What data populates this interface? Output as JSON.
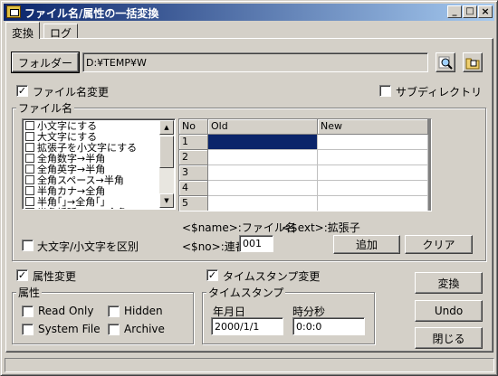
{
  "window": {
    "title": "ファイル名/属性の一括変換",
    "minimize": "_",
    "maximize": "□",
    "close": "×"
  },
  "tabs": [
    "変換",
    "ログ"
  ],
  "folder": {
    "button": "フォルダー",
    "path": "D:¥TEMP¥W"
  },
  "options": {
    "rename_checked": true,
    "rename_label": "ファイル名変更",
    "subdir_checked": false,
    "subdir_label": "サブディレクトリ"
  },
  "filename_group": {
    "title": "ファイル名",
    "rules": [
      {
        "label": "小文字にする",
        "checked": false
      },
      {
        "label": "大文字にする",
        "checked": false
      },
      {
        "label": "拡張子を小文字にする",
        "checked": false
      },
      {
        "label": "全角数字→半角",
        "checked": false
      },
      {
        "label": "全角英字→半角",
        "checked": false
      },
      {
        "label": "全角スペース→半角",
        "checked": false
      },
      {
        "label": "半角カナ→全角",
        "checked": false
      },
      {
        "label": "半角｢｣→全角｢｣",
        "checked": false
      },
      {
        "label": "半角括弧( )[ ]→全角",
        "checked": false
      }
    ],
    "grid": {
      "headers": [
        "No",
        "Old",
        "New"
      ],
      "rows": [
        {
          "no": "1",
          "old": "",
          "new": ""
        },
        {
          "no": "2",
          "old": "",
          "new": ""
        },
        {
          "no": "3",
          "old": "",
          "new": ""
        },
        {
          "no": "4",
          "old": "",
          "new": ""
        },
        {
          "no": "5",
          "old": "",
          "new": ""
        }
      ]
    },
    "case_sensitive_label": "大文字/小文字を区別",
    "case_sensitive_checked": false,
    "hint_name": "<$name>:ファイル名",
    "hint_ext": "<$ext>:拡張子",
    "hint_no": "<$no>:連番",
    "seq_value": "001",
    "add_button": "追加",
    "clear_button": "クリア"
  },
  "attributes": {
    "change_checked": true,
    "change_label": "属性変更",
    "group_title": "属性",
    "read_only": "Read Only",
    "hidden": "Hidden",
    "system_file": "System File",
    "archive": "Archive"
  },
  "timestamp": {
    "change_checked": true,
    "change_label": "タイムスタンプ変更",
    "group_title": "タイムスタンプ",
    "date_label": "年月日",
    "time_label": "時分秒",
    "date_value": "2000/1/1",
    "time_value": "0:0:0"
  },
  "actions": {
    "convert": "変換",
    "undo": "Undo",
    "close": "閉じる"
  },
  "colors": {
    "selection": "#0a246a",
    "face": "#d4d0c8"
  }
}
